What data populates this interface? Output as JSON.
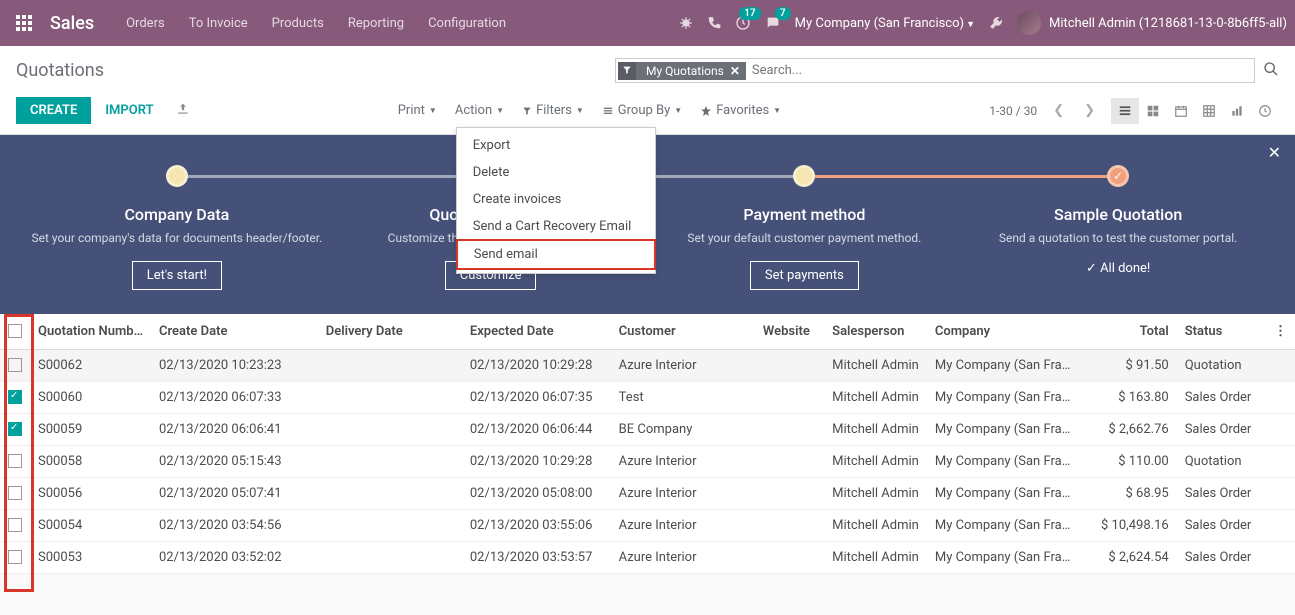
{
  "nav": {
    "brand": "Sales",
    "menu": [
      "Orders",
      "To Invoice",
      "Products",
      "Reporting",
      "Configuration"
    ],
    "badge1": "17",
    "badge2": "7",
    "company": "My Company (San Francisco)",
    "user": "Mitchell Admin (1218681-13-0-8b6ff5-all)"
  },
  "breadcrumb": "Quotations",
  "search": {
    "facet": "My Quotations",
    "placeholder": "Search..."
  },
  "buttons": {
    "create": "CREATE",
    "import": "IMPORT"
  },
  "toolbar": {
    "print": "Print",
    "action": "Action",
    "filters": "Filters",
    "groupby": "Group By",
    "favorites": "Favorites"
  },
  "action_menu": [
    "Export",
    "Delete",
    "Create invoices",
    "Send a Cart Recovery Email",
    "Send email"
  ],
  "pager": "1-30 / 30",
  "onboard": {
    "steps": [
      {
        "title": "Company Data",
        "desc": "Set your company's data for documents header/footer.",
        "btn": "Let's start!",
        "done": false
      },
      {
        "title": "Quotation Layout",
        "desc": "Customize the look of your quotations.",
        "btn": "Customize",
        "done": false
      },
      {
        "title": "Payment method",
        "desc": "Set your default customer payment method.",
        "btn": "Set payments",
        "done": false
      },
      {
        "title": "Sample Quotation",
        "desc": "Send a quotation to test the customer portal.",
        "btn": "✓ All done!",
        "done": true
      }
    ]
  },
  "cols": {
    "quotation": "Quotation Numb…",
    "create": "Create Date",
    "delivery": "Delivery Date",
    "expected": "Expected Date",
    "customer": "Customer",
    "website": "Website",
    "salesperson": "Salesperson",
    "company": "Company",
    "total": "Total",
    "status": "Status"
  },
  "rows": [
    {
      "chk": false,
      "q": "S00062",
      "cd": "02/13/2020 10:23:23",
      "dd": "",
      "ed": "02/13/2020 10:29:28",
      "cust": "Azure Interior",
      "web": "",
      "sp": "Mitchell Admin",
      "co": "My Company (San Fra…",
      "tot": "$ 91.50",
      "st": "Quotation"
    },
    {
      "chk": true,
      "q": "S00060",
      "cd": "02/13/2020 06:07:33",
      "dd": "",
      "ed": "02/13/2020 06:07:35",
      "cust": "Test",
      "web": "",
      "sp": "Mitchell Admin",
      "co": "My Company (San Fra…",
      "tot": "$ 163.80",
      "st": "Sales Order"
    },
    {
      "chk": true,
      "q": "S00059",
      "cd": "02/13/2020 06:06:41",
      "dd": "",
      "ed": "02/13/2020 06:06:44",
      "cust": "BE Company",
      "web": "",
      "sp": "Mitchell Admin",
      "co": "My Company (San Fra…",
      "tot": "$ 2,662.76",
      "st": "Sales Order"
    },
    {
      "chk": false,
      "q": "S00058",
      "cd": "02/13/2020 05:15:43",
      "dd": "",
      "ed": "02/13/2020 10:29:28",
      "cust": "Azure Interior",
      "web": "",
      "sp": "Mitchell Admin",
      "co": "My Company (San Fra…",
      "tot": "$ 110.00",
      "st": "Quotation"
    },
    {
      "chk": false,
      "q": "S00056",
      "cd": "02/13/2020 05:07:41",
      "dd": "",
      "ed": "02/13/2020 05:08:00",
      "cust": "Azure Interior",
      "web": "",
      "sp": "Mitchell Admin",
      "co": "My Company (San Fra…",
      "tot": "$ 68.95",
      "st": "Sales Order"
    },
    {
      "chk": false,
      "q": "S00054",
      "cd": "02/13/2020 03:54:56",
      "dd": "",
      "ed": "02/13/2020 03:55:06",
      "cust": "Azure Interior",
      "web": "",
      "sp": "Mitchell Admin",
      "co": "My Company (San Fra…",
      "tot": "$ 10,498.16",
      "st": "Sales Order"
    },
    {
      "chk": false,
      "q": "S00053",
      "cd": "02/13/2020 03:52:02",
      "dd": "",
      "ed": "02/13/2020 03:53:57",
      "cust": "Azure Interior",
      "web": "",
      "sp": "Mitchell Admin",
      "co": "My Company (San Fra…",
      "tot": "$ 2,624.54",
      "st": "Sales Order"
    }
  ]
}
